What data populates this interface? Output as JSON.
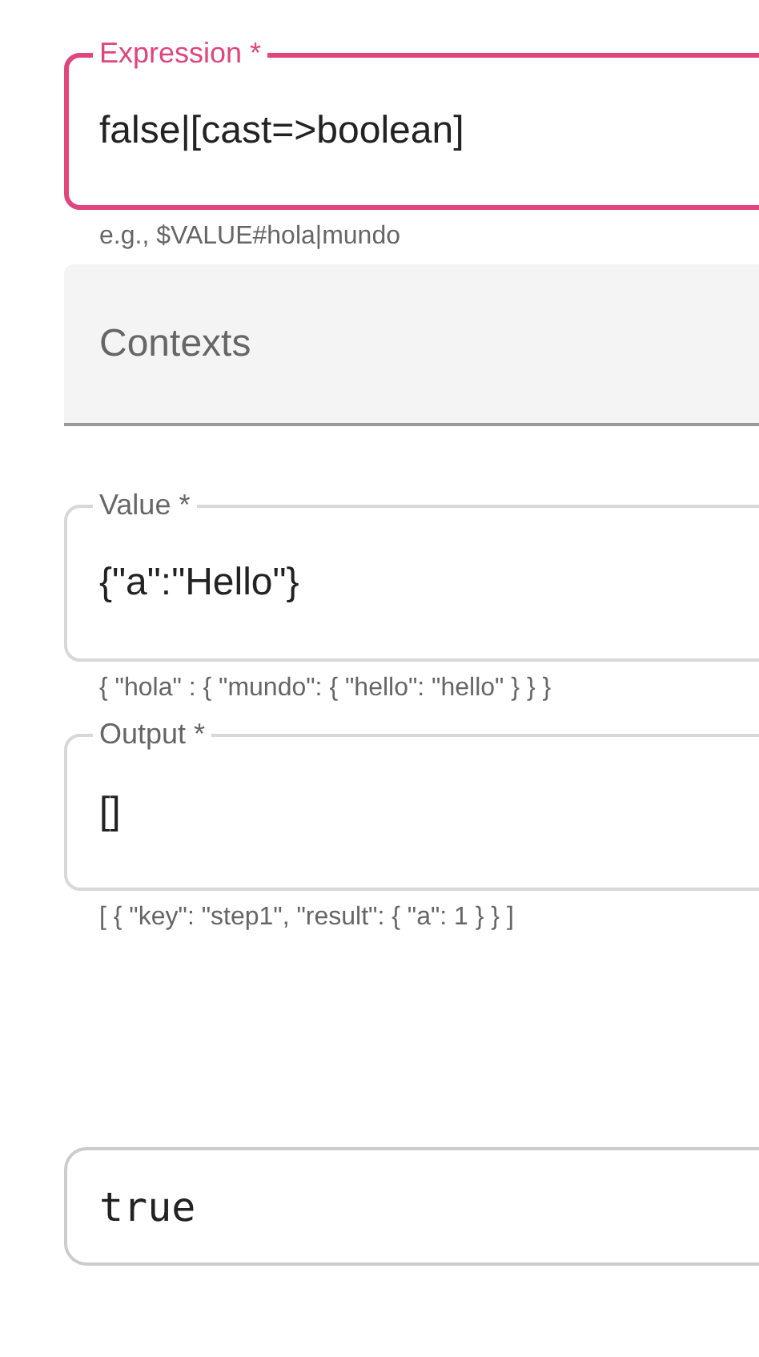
{
  "fields": [
    {
      "kind": "outlined",
      "label": "Expression *",
      "value": "false|[cast=>boolean]",
      "focused": true,
      "helper": "e.g., $VALUE#hola|mundo"
    },
    {
      "kind": "filled",
      "placeholder": "Contexts"
    },
    {
      "kind": "outlined",
      "label": "Value *",
      "value": "{\"a\":\"Hello\"}",
      "focused": false,
      "helper": "{ \"hola\" : { \"mundo\": { \"hello\": \"hello\" } } }"
    },
    {
      "kind": "outlined",
      "label": "Output *",
      "value": "[]",
      "focused": false,
      "helper": "[ { \"key\": \"step1\", \"result\": { \"a\": 1 } } ]"
    }
  ],
  "result": {
    "value": "true"
  }
}
